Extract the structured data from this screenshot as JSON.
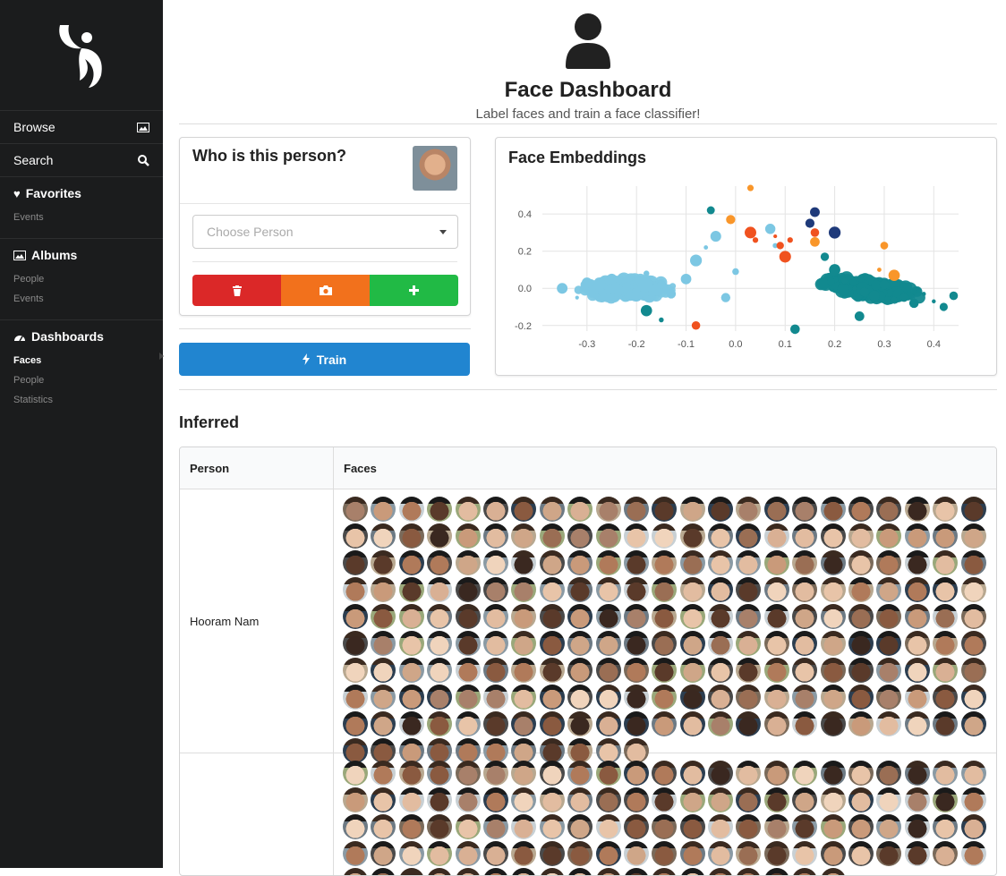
{
  "sidebar": {
    "browse": "Browse",
    "search": "Search",
    "favorites": {
      "title": "Favorites",
      "items": [
        "Events"
      ]
    },
    "albums": {
      "title": "Albums",
      "items": [
        "People",
        "Events"
      ]
    },
    "dashboards": {
      "title": "Dashboards",
      "items": [
        "Faces",
        "People",
        "Statistics"
      ],
      "active": "Faces"
    }
  },
  "header": {
    "title": "Face Dashboard",
    "subtitle": "Label faces and train a face classifier!"
  },
  "labeler": {
    "question": "Who is this person?",
    "select_placeholder": "Choose Person",
    "delete_icon": "trash-icon",
    "camera_icon": "camera-icon",
    "add_icon": "plus-icon"
  },
  "train": {
    "label": "Train",
    "icon": "lightning-icon"
  },
  "colors": {
    "red": "#db2828",
    "orange": "#f2711c",
    "green": "#21ba45",
    "blue": "#2185d0"
  },
  "embeddings": {
    "title": "Face Embeddings",
    "chart_data": {
      "type": "scatter",
      "title": "Face Embeddings",
      "xlim": [
        -0.39,
        0.45
      ],
      "ylim": [
        -0.23,
        0.55
      ],
      "xticks": [
        -0.3,
        -0.2,
        -0.1,
        0.0,
        0.1,
        0.2,
        0.3,
        0.4
      ],
      "yticks": [
        -0.2,
        0.0,
        0.2,
        0.4
      ],
      "grid": true,
      "series": [
        {
          "color": "#7cc7e3",
          "cluster_center": [
            -0.22,
            0.0
          ],
          "points": [
            [
              -0.35,
              0.0
            ],
            [
              -0.32,
              -0.05
            ],
            [
              -0.3,
              0.03
            ],
            [
              -0.27,
              -0.02
            ],
            [
              -0.25,
              0.05
            ],
            [
              -0.22,
              0.01
            ],
            [
              -0.2,
              -0.04
            ],
            [
              -0.18,
              0.08
            ],
            [
              -0.15,
              0.02
            ],
            [
              -0.13,
              -0.03
            ],
            [
              -0.1,
              0.05
            ],
            [
              -0.08,
              0.15
            ],
            [
              -0.06,
              0.22
            ],
            [
              -0.04,
              0.28
            ],
            [
              0.0,
              0.09
            ],
            [
              -0.02,
              -0.05
            ],
            [
              0.07,
              0.32
            ],
            [
              0.08,
              0.23
            ]
          ]
        },
        {
          "color": "#12898f",
          "cluster_center": [
            0.27,
            0.0
          ],
          "points": [
            [
              0.18,
              0.17
            ],
            [
              0.2,
              0.1
            ],
            [
              0.22,
              0.04
            ],
            [
              0.24,
              0.0
            ],
            [
              0.26,
              -0.02
            ],
            [
              0.28,
              -0.04
            ],
            [
              0.3,
              0.02
            ],
            [
              0.32,
              -0.06
            ],
            [
              0.34,
              -0.05
            ],
            [
              0.36,
              -0.08
            ],
            [
              0.38,
              -0.03
            ],
            [
              0.4,
              -0.07
            ],
            [
              0.42,
              -0.1
            ],
            [
              0.44,
              -0.04
            ],
            [
              0.25,
              -0.15
            ],
            [
              0.12,
              -0.22
            ],
            [
              -0.15,
              -0.17
            ],
            [
              -0.18,
              -0.12
            ],
            [
              -0.05,
              0.42
            ]
          ]
        },
        {
          "color": "#f0521f",
          "points": [
            [
              0.04,
              0.26
            ],
            [
              0.08,
              0.28
            ],
            [
              0.09,
              0.23
            ],
            [
              0.11,
              0.26
            ],
            [
              0.16,
              0.3
            ],
            [
              0.03,
              0.3
            ],
            [
              -0.08,
              -0.2
            ],
            [
              0.1,
              0.17
            ]
          ]
        },
        {
          "color": "#f9962a",
          "points": [
            [
              0.03,
              0.54
            ],
            [
              -0.01,
              0.37
            ],
            [
              0.3,
              0.23
            ],
            [
              0.29,
              0.1
            ],
            [
              0.32,
              0.07
            ],
            [
              0.16,
              0.25
            ]
          ]
        },
        {
          "color": "#1f3a7a",
          "points": [
            [
              0.15,
              0.35
            ],
            [
              0.16,
              0.41
            ],
            [
              0.2,
              0.3
            ]
          ]
        }
      ]
    }
  },
  "inferred": {
    "title": "Inferred",
    "headers": [
      "Person",
      "Faces"
    ],
    "rows": [
      {
        "person": "Hooram Nam",
        "count": 218
      },
      {
        "person": "",
        "count": 110
      }
    ]
  }
}
